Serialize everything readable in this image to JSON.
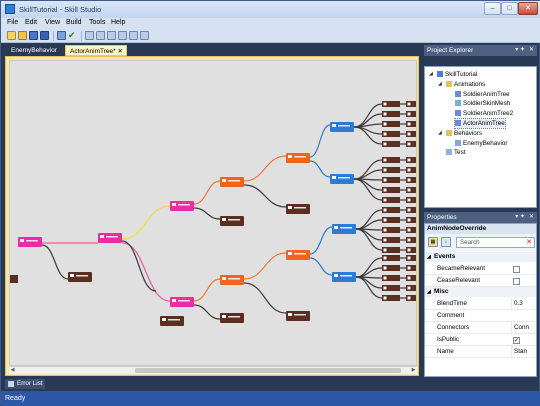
{
  "window": {
    "title": "SkillTutorial - Skill Studio",
    "min": "–",
    "max": "□",
    "close": "✕"
  },
  "menu": [
    "File",
    "Edit",
    "View",
    "Build",
    "Tools",
    "Help"
  ],
  "toolbar": {
    "icons": [
      "new-icon",
      "open-icon",
      "save-icon",
      "save-all-icon",
      "build-icon",
      "check-icon",
      "layout-icon",
      "layout-icon",
      "layout-icon",
      "layout-icon",
      "layout-icon",
      "layout-icon"
    ]
  },
  "tabs": [
    {
      "label": "EnemyBehavior",
      "active": false
    },
    {
      "label": "ActorAnimTree*",
      "active": true,
      "close": "✕"
    }
  ],
  "project_explorer": {
    "title": "Project Explorer",
    "pin": "▾ ✦",
    "close": "✕",
    "items": [
      {
        "label": "SkillTutorial",
        "depth": 0,
        "icon": "solution-icon",
        "expander": "◢"
      },
      {
        "label": "Animations",
        "depth": 1,
        "icon": "folder-icon",
        "expander": "◢"
      },
      {
        "label": "SoldierAnimTree",
        "depth": 2,
        "icon": "anim-tree-icon"
      },
      {
        "label": "SoldierSkinMesh",
        "depth": 2,
        "icon": "skin-mesh-icon"
      },
      {
        "label": "SoldierAnimTree2",
        "depth": 2,
        "icon": "anim-tree-icon"
      },
      {
        "label": "ActorAnimTree",
        "depth": 2,
        "icon": "anim-tree-icon",
        "selected": true
      },
      {
        "label": "Behaviors",
        "depth": 1,
        "icon": "folder-icon",
        "expander": "◢"
      },
      {
        "label": "EnemyBehavior",
        "depth": 2,
        "icon": "behavior-icon"
      },
      {
        "label": "Test",
        "depth": 1,
        "icon": "test-icon"
      }
    ]
  },
  "properties": {
    "title": "Properties",
    "pin": "▾ ✦",
    "close": "✕",
    "object": "AnimNodeOverride",
    "search_placeholder": "Search",
    "clear": "✕",
    "categories": [
      {
        "name": "Events",
        "rows": [
          {
            "name": "BecameRelevant",
            "type": "check",
            "checked": false
          },
          {
            "name": "CeaseRelevant",
            "type": "check",
            "checked": false
          }
        ]
      },
      {
        "name": "Misc",
        "rows": [
          {
            "name": "BlendTime",
            "type": "text",
            "value": "0.3"
          },
          {
            "name": "Comment",
            "type": "text",
            "value": ""
          },
          {
            "name": "Connectors",
            "type": "text",
            "value": "Conn"
          },
          {
            "name": "IsPublic",
            "type": "check",
            "checked": true
          },
          {
            "name": "Name",
            "type": "text",
            "value": "Stan"
          }
        ]
      }
    ]
  },
  "error_list": {
    "label": "Error List"
  },
  "status": {
    "text": "Ready"
  },
  "graph": {
    "colors": {
      "pink": "#e92ba6",
      "orange": "#f2641c",
      "blue": "#2b7bd8",
      "brown": "#5a2f22",
      "yellow": "#f0e03a",
      "wire_pink": "#e85aa0",
      "wire_orange": "#e9793a",
      "wire_blue": "#2d78d0",
      "wire_dark": "#3b3b3b"
    },
    "nodes": [
      {
        "id": "n0",
        "color": "pink",
        "w": 1
      },
      {
        "id": "n1",
        "color": "brown",
        "w": 1
      },
      {
        "id": "n2",
        "color": "pink",
        "w": 1
      },
      {
        "id": "n3",
        "color": "brown",
        "w": 1
      },
      {
        "id": "n4",
        "color": "pink",
        "w": 1
      },
      {
        "id": "n5",
        "color": "brown",
        "w": 1
      },
      {
        "id": "n6",
        "color": "pink",
        "w": 1
      },
      {
        "id": "n7",
        "color": "brown",
        "w": 1
      },
      {
        "id": "n8",
        "color": "orange",
        "w": 1
      },
      {
        "id": "n9",
        "color": "brown",
        "w": 1
      },
      {
        "id": "n10",
        "color": "orange",
        "w": 1
      },
      {
        "id": "n11",
        "color": "brown",
        "w": 1
      },
      {
        "id": "n12",
        "color": "orange",
        "w": 1
      },
      {
        "id": "n13",
        "color": "brown",
        "w": 1
      },
      {
        "id": "n14",
        "color": "blue",
        "w": 1
      },
      {
        "id": "n15",
        "color": "blue",
        "w": 1
      },
      {
        "id": "n16",
        "color": "orange",
        "w": 1
      },
      {
        "id": "n17",
        "color": "brown",
        "w": 1
      },
      {
        "id": "n18",
        "color": "orange",
        "w": 1
      },
      {
        "id": "n19",
        "color": "blue",
        "w": 1
      },
      {
        "id": "n20",
        "color": "blue",
        "w": 1
      },
      {
        "id": "n21",
        "color": "brown",
        "w": 1
      }
    ],
    "leaf_columns": 3
  }
}
